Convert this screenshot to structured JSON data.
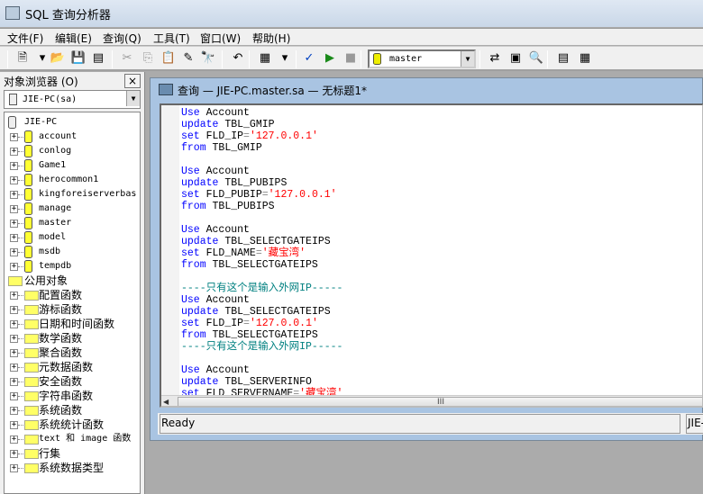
{
  "window": {
    "title": "SQL 查询分析器"
  },
  "menu": [
    "文件(F)",
    "编辑(E)",
    "查询(Q)",
    "工具(T)",
    "窗口(W)",
    "帮助(H)"
  ],
  "toolbar": {
    "database": "master",
    "icons": [
      "new-query-icon",
      "dropdown-icon",
      "open-icon",
      "save-icon",
      "load-script-icon",
      "cut-icon",
      "copy-icon",
      "paste-icon",
      "clear-icon",
      "find-icon",
      "undo-icon",
      "results-grid-icon",
      "dropdown-icon",
      "parse-check-icon",
      "execute-icon",
      "stop-icon"
    ],
    "right_icons": [
      "object-browser-icon",
      "object-search-icon",
      "estimated-plan-icon",
      "properties-icon",
      "show-results-icon"
    ]
  },
  "object_browser": {
    "title": "对象浏览器 (O)",
    "close": "×",
    "server_select": "JIE-PC(sa)",
    "server": "JIE-PC",
    "databases": [
      "account",
      "conlog",
      "Game1",
      "herocommon1",
      "kingforeiserverbas",
      "manage",
      "master",
      "model",
      "msdb",
      "tempdb"
    ],
    "common_objects": "公用对象",
    "folders": [
      "配置函数",
      "游标函数",
      "日期和时间函数",
      "数学函数",
      "聚合函数",
      "元数据函数",
      "安全函数",
      "字符串函数",
      "系统函数",
      "系统统计函数",
      "text 和 image 函数",
      "行集",
      "系统数据类型"
    ]
  },
  "query_window": {
    "title": "查询 — JIE-PC.master.sa — 无标题1*",
    "code": [
      [
        [
          "kw",
          "Use"
        ],
        [
          "",
          "Account"
        ]
      ],
      [
        [
          "kw",
          "update"
        ],
        [
          "",
          "TBL_GMIP"
        ]
      ],
      [
        [
          "kw",
          "set"
        ],
        [
          "",
          "FLD_IP"
        ],
        [
          "op",
          "="
        ],
        [
          "str",
          "'127.0.0.1'"
        ]
      ],
      [
        [
          "kw",
          "from"
        ],
        [
          "",
          "TBL_GMIP"
        ]
      ],
      [],
      [
        [
          "kw",
          "Use"
        ],
        [
          "",
          "Account"
        ]
      ],
      [
        [
          "kw",
          "update"
        ],
        [
          "",
          "TBL_PUBIPS"
        ]
      ],
      [
        [
          "kw",
          "set"
        ],
        [
          "",
          "FLD_PUBIP"
        ],
        [
          "op",
          "="
        ],
        [
          "str",
          "'127.0.0.1'"
        ]
      ],
      [
        [
          "kw",
          "from"
        ],
        [
          "",
          "TBL_PUBIPS"
        ]
      ],
      [],
      [
        [
          "kw",
          "Use"
        ],
        [
          "",
          "Account"
        ]
      ],
      [
        [
          "kw",
          "update"
        ],
        [
          "",
          "TBL_SELECTGATEIPS"
        ]
      ],
      [
        [
          "kw",
          "set"
        ],
        [
          "",
          "FLD_NAME"
        ],
        [
          "op",
          "="
        ],
        [
          "str",
          "'藏宝湾'"
        ]
      ],
      [
        [
          "kw",
          "from"
        ],
        [
          "",
          "TBL_SELECTGATEIPS"
        ]
      ],
      [],
      [
        [
          "cmt",
          "----只有这个是输入外网IP-----"
        ]
      ],
      [
        [
          "kw",
          "Use"
        ],
        [
          "",
          "Account"
        ]
      ],
      [
        [
          "kw",
          "update"
        ],
        [
          "",
          "TBL_SELECTGATEIPS"
        ]
      ],
      [
        [
          "kw",
          "set"
        ],
        [
          "",
          "FLD_IP"
        ],
        [
          "op",
          "="
        ],
        [
          "str",
          "'127.0.0.1'"
        ]
      ],
      [
        [
          "kw",
          "from"
        ],
        [
          "",
          "TBL_SELECTGATEIPS"
        ]
      ],
      [
        [
          "cmt",
          "----只有这个是输入外网IP-----"
        ]
      ],
      [],
      [
        [
          "kw",
          "Use"
        ],
        [
          "",
          "Account"
        ]
      ],
      [
        [
          "kw",
          "update"
        ],
        [
          "",
          "TBL_SERVERINFO"
        ]
      ],
      [
        [
          "kw",
          "set"
        ],
        [
          "",
          "FLD_SERVERNAME"
        ],
        [
          "op",
          "="
        ],
        [
          "str",
          "'藏宝湾'"
        ]
      ]
    ],
    "scroll_thumb": "III",
    "status": "Ready",
    "status_conn": "JIE-PC"
  }
}
